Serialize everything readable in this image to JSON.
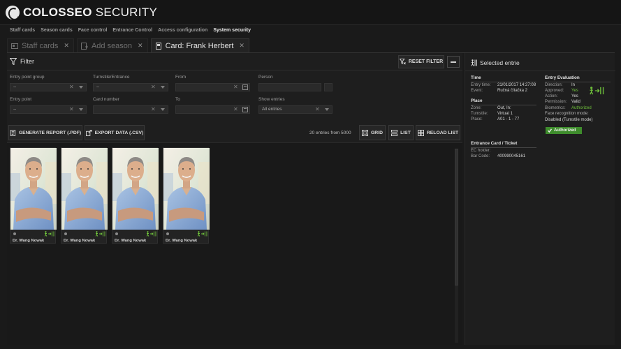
{
  "app": {
    "brand_bold": "COLOSSEO",
    "brand_light": "SECURITY"
  },
  "nav": {
    "items": [
      "Staff cards",
      "Season cards",
      "Face control",
      "Entrance Control",
      "Access configuration",
      "System security"
    ],
    "active_index": 5
  },
  "tabs": [
    {
      "label": "Staff cards",
      "icon": "staff-card-icon",
      "active": false
    },
    {
      "label": "Add season",
      "icon": "add-season-icon",
      "active": false
    },
    {
      "label": "Card: Frank Herbert",
      "icon": "card-icon",
      "active": true
    }
  ],
  "filter": {
    "title": "Filter",
    "reset_label": "RESET FILTER",
    "fields": {
      "entry_point_group": {
        "label": "Entry point group",
        "value": "--"
      },
      "turnstile": {
        "label": "Turnstile/Entrance",
        "value": "--"
      },
      "from": {
        "label": "From",
        "value": ""
      },
      "person": {
        "label": "Person",
        "value": ""
      },
      "entry_point": {
        "label": "Entry point",
        "value": "--"
      },
      "card_number": {
        "label": "Card number",
        "value": ""
      },
      "to": {
        "label": "To",
        "value": ""
      },
      "show_entries": {
        "label": "Show entries",
        "value": "All entries"
      }
    }
  },
  "toolbar": {
    "generate_report": "GENERATE REPORT (.PDF)",
    "export_data": "EXPORT DATA (.CSV)",
    "entries_count": "20 entries from 5000",
    "grid": "GRID",
    "list": "LIST",
    "reload": "RELOAD LIST"
  },
  "entries": [
    {
      "name": "Dr. Wang Nowak",
      "status": "entry-in-icon"
    },
    {
      "name": "Dr. Wang Nowak",
      "status": "entry-in-icon"
    },
    {
      "name": "Dr. Wang Nowak",
      "status": "entry-in-icon"
    },
    {
      "name": "Dr. Wang Nowak",
      "status": "entry-in-icon"
    }
  ],
  "selected": {
    "title": "Selected entrie",
    "time": {
      "title": "Time",
      "entry_time_label": "Entry time:",
      "entry_time": "21/01/2017 14:27:08",
      "event_label": "Event:",
      "event": "Ručná čítačka 2"
    },
    "place": {
      "title": "Place",
      "zone_label": "Zone:",
      "zone": "Out, In:",
      "turnstile_label": "Turnstile:",
      "turnstile": "Virtual 1",
      "place_label": "Place:",
      "place": "A01 - 1 - 77"
    },
    "evaluation": {
      "title": "Entry Evaluation",
      "direction_label": "Direction:",
      "direction": "In",
      "approved_label": "Approved:",
      "approved": "Yes",
      "action_label": "Action:",
      "action": "Yes",
      "permission_label": "Permission:",
      "permission": "Valid",
      "biometrics_label": "Biometrics:",
      "biometrics": "Authorized",
      "face_mode_label": "Face recognition mode:",
      "face_mode": "Disabled (Turnstile mode)",
      "badge": "Authorized"
    },
    "card": {
      "title": "Entrance Card / Ticket",
      "holder_label": "EC holder:",
      "holder": "",
      "barcode_label": "Bar Code:",
      "barcode": "400990045161"
    }
  },
  "colors": {
    "accent_green": "#6fc13b",
    "badge_green": "#3e8c2c",
    "background": "#1a1a1a"
  }
}
